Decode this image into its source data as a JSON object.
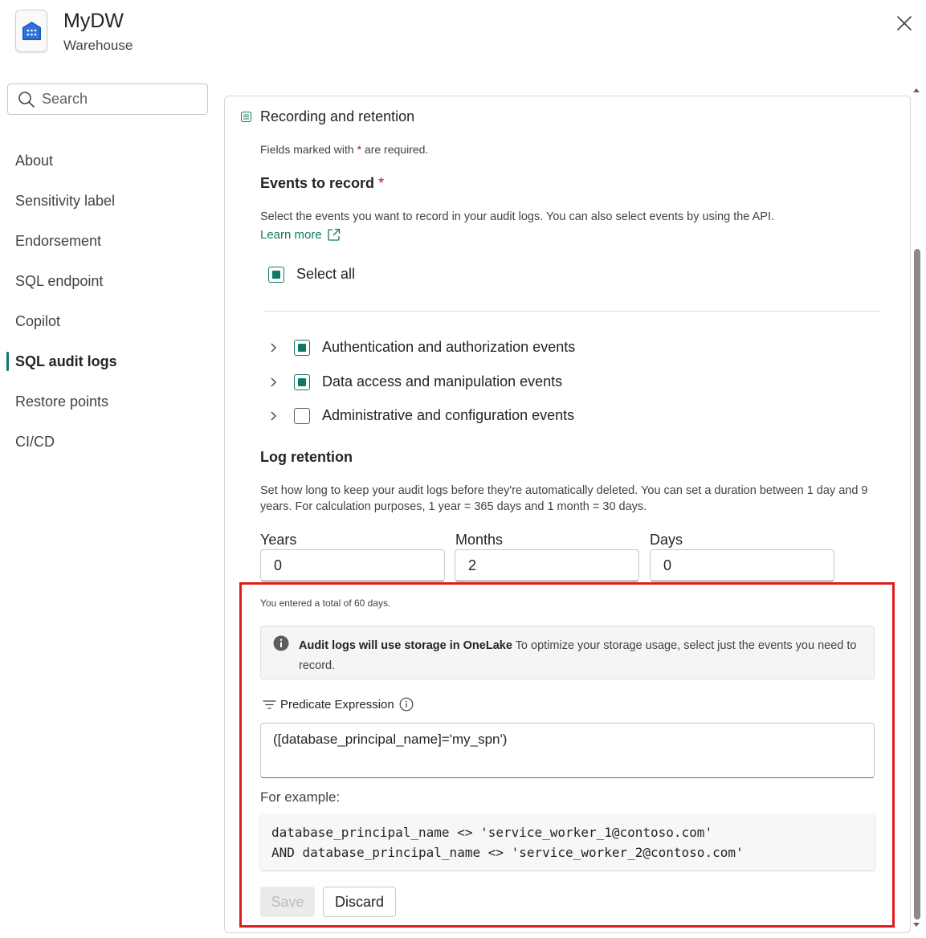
{
  "header": {
    "title": "MyDW",
    "subtitle": "Warehouse"
  },
  "search": {
    "placeholder": "Search"
  },
  "sidebar": {
    "items": [
      {
        "label": "About"
      },
      {
        "label": "Sensitivity label"
      },
      {
        "label": "Endorsement"
      },
      {
        "label": "SQL endpoint"
      },
      {
        "label": "Copilot"
      },
      {
        "label": "SQL audit logs",
        "active": true
      },
      {
        "label": "Restore points"
      },
      {
        "label": "CI/CD"
      }
    ]
  },
  "section": {
    "title": "Recording and retention",
    "required_note_prefix": "Fields marked with",
    "required_star": "*",
    "required_note_suffix": "are required."
  },
  "events": {
    "heading": "Events to record",
    "required_star": "*",
    "description": "Select the events you want to record in your audit logs. You can also select events by using the API.",
    "learn_more": "Learn more",
    "select_all": {
      "label": "Select all",
      "checked": true
    },
    "groups": [
      {
        "label": "Authentication and authorization events",
        "checked": true
      },
      {
        "label": "Data access and manipulation events",
        "checked": true
      },
      {
        "label": "Administrative and configuration events",
        "checked": false
      }
    ]
  },
  "retention": {
    "heading": "Log retention",
    "description": "Set how long to keep your audit logs before they're automatically deleted. You can set a duration between 1 day and 9 years. For calculation purposes, 1 year = 365 days and 1 month = 30 days.",
    "years_label": "Years",
    "years_value": "0",
    "months_label": "Months",
    "months_value": "2",
    "days_label": "Days",
    "days_value": "0",
    "total_note": "You entered a total of 60 days."
  },
  "info": {
    "bold": "Audit logs will use storage in OneLake",
    "text": "To optimize your storage usage, select just the events you need to record."
  },
  "predicate": {
    "label": "Predicate Expression",
    "value": "([database_principal_name]='my_spn')",
    "example_label": "For example:",
    "example_code": "database_principal_name <> 'service_worker_1@contoso.com'\nAND database_principal_name <> 'service_worker_2@contoso.com'"
  },
  "actions": {
    "save": "Save",
    "discard": "Discard"
  },
  "colors": {
    "accent": "#117865",
    "required": "#c50f1f",
    "highlight": "#e01b1b"
  }
}
